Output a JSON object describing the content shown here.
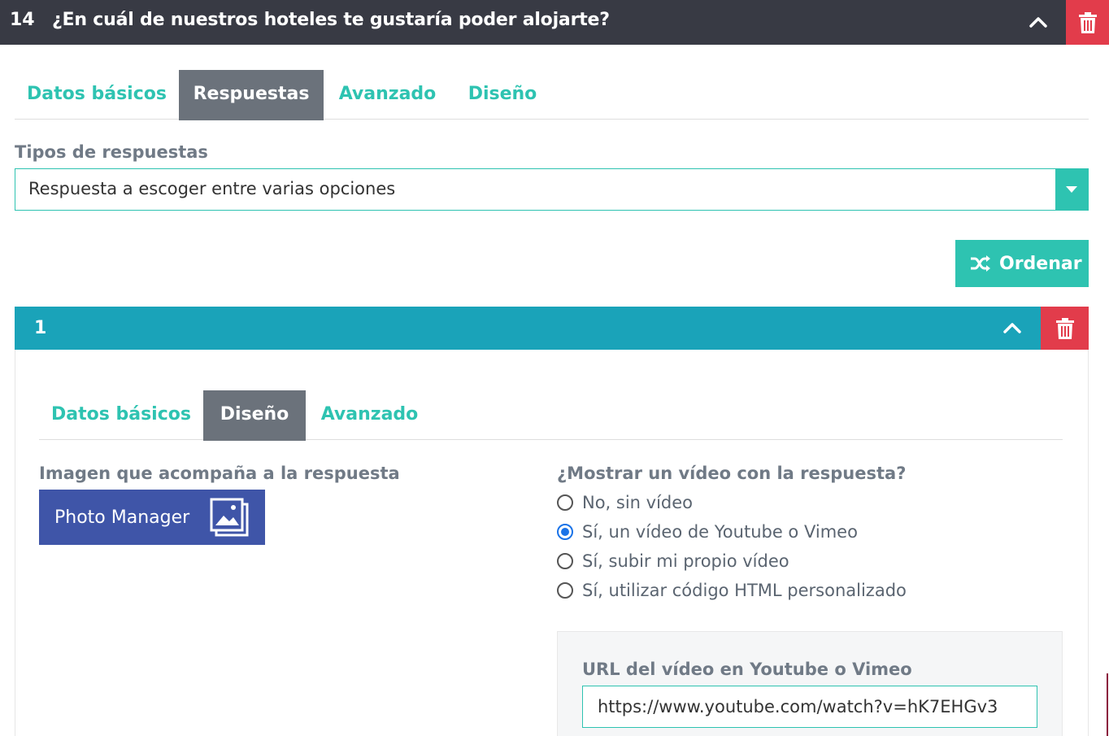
{
  "question": {
    "number": "14",
    "title": "¿En cuál de nuestros hoteles te gustaría poder alojarte?"
  },
  "question_tabs": [
    {
      "label": "Datos básicos",
      "active": false
    },
    {
      "label": "Respuestas",
      "active": true
    },
    {
      "label": "Avanzado",
      "active": false
    },
    {
      "label": "Diseño",
      "active": false
    }
  ],
  "answer_type": {
    "label": "Tipos de respuestas",
    "value": "Respuesta a escoger entre varias opciones"
  },
  "sort_button": {
    "label": "Ordenar",
    "icon": "shuffle-icon"
  },
  "answer": {
    "number": "1",
    "tabs": [
      {
        "label": "Datos básicos",
        "active": false
      },
      {
        "label": "Diseño",
        "active": true
      },
      {
        "label": "Avanzado",
        "active": false
      }
    ],
    "image_label": "Imagen que acompaña a la respuesta",
    "photo_manager_label": "Photo Manager",
    "video_question": "¿Mostrar un vídeo con la respuesta?",
    "video_options": [
      {
        "label": "No, sin vídeo",
        "checked": false
      },
      {
        "label": "Sí, un vídeo de Youtube o Vimeo",
        "checked": true
      },
      {
        "label": "Sí, subir mi propio vídeo",
        "checked": false
      },
      {
        "label": "Sí, utilizar código HTML personalizado",
        "checked": false
      }
    ],
    "url_label": "URL del vídeo en Youtube o Vimeo",
    "url_value": "https://www.youtube.com/watch?v=hK7EHGv3"
  },
  "colors": {
    "accent": "#2ec3b1",
    "header_dark": "#383a44",
    "answer_bar": "#1aa3b9",
    "delete_red": "#e23c4b",
    "photo_manager": "#3f55a8",
    "tab_active": "#6b727b"
  }
}
